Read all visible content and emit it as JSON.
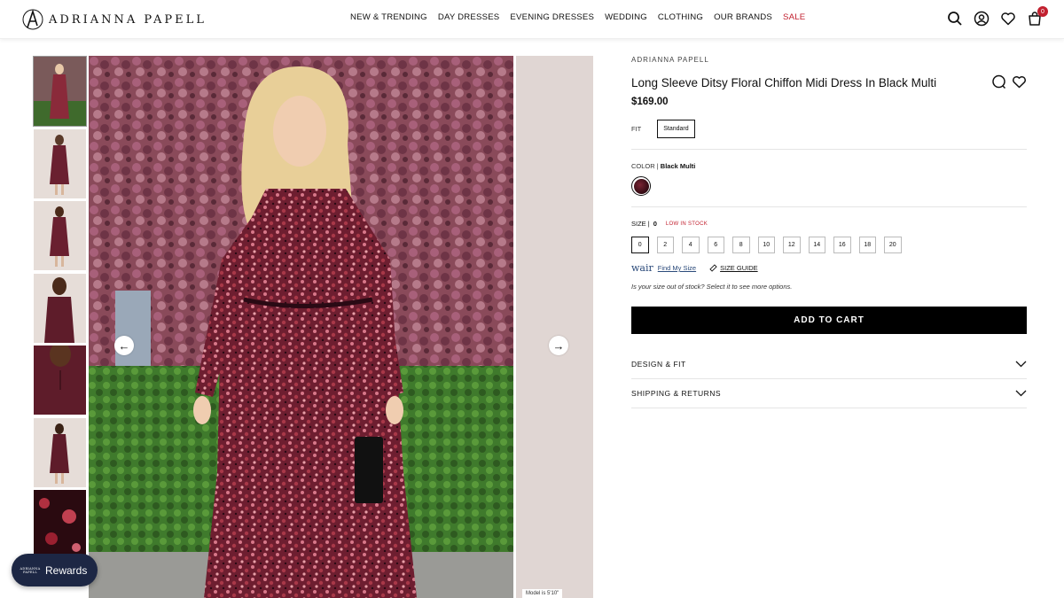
{
  "header": {
    "brand_name": "ADRIANNA PAPELL",
    "nav": [
      {
        "label": "NEW & TRENDING"
      },
      {
        "label": "DAY DRESSES"
      },
      {
        "label": "EVENING DRESSES"
      },
      {
        "label": "WEDDING"
      },
      {
        "label": "CLOTHING"
      },
      {
        "label": "OUR BRANDS"
      },
      {
        "label": "SALE"
      }
    ],
    "icons": [
      "search-icon",
      "account-icon",
      "wishlist-icon",
      "cart-icon"
    ],
    "cart_count": "0"
  },
  "gallery": {
    "thumbnails_count": 7,
    "peek_tag": "Model is 5'10\"",
    "arrow_left": "←",
    "arrow_right": "→"
  },
  "product": {
    "brand": "ADRIANNA PAPELL",
    "title": "Long Sleeve Ditsy Floral Chiffon Midi Dress In Black Multi",
    "price": "$169.00",
    "fit_label": "FIT",
    "fit_value": "Standard",
    "color_label": "COLOR |",
    "color_value": "Black Multi",
    "size_label": "SIZE  |",
    "size_value": "0",
    "stock_status": "LOW IN STOCK",
    "sizes": [
      "0",
      "2",
      "4",
      "6",
      "8",
      "10",
      "12",
      "14",
      "16",
      "18",
      "20"
    ],
    "selected_size": "0",
    "wair_logo": "wair",
    "find_my_size": "Find My Size",
    "size_guide": "SIZE GUIDE",
    "oos_note": "Is your size out of stock? Select it to see more options.",
    "add_to_cart": "ADD TO CART",
    "accordion": [
      {
        "label": "DESIGN & FIT"
      },
      {
        "label": "SHIPPING & RETURNS"
      }
    ]
  },
  "rewards": {
    "label": "Rewards",
    "logo_line1": "ADRIANNA",
    "logo_line2": "PAPELL"
  },
  "colors": {
    "accent_sale": "#c2202f",
    "button_bg": "#000000",
    "rewards_bg": "#1d2744",
    "link_blue": "#2b4a7a"
  }
}
